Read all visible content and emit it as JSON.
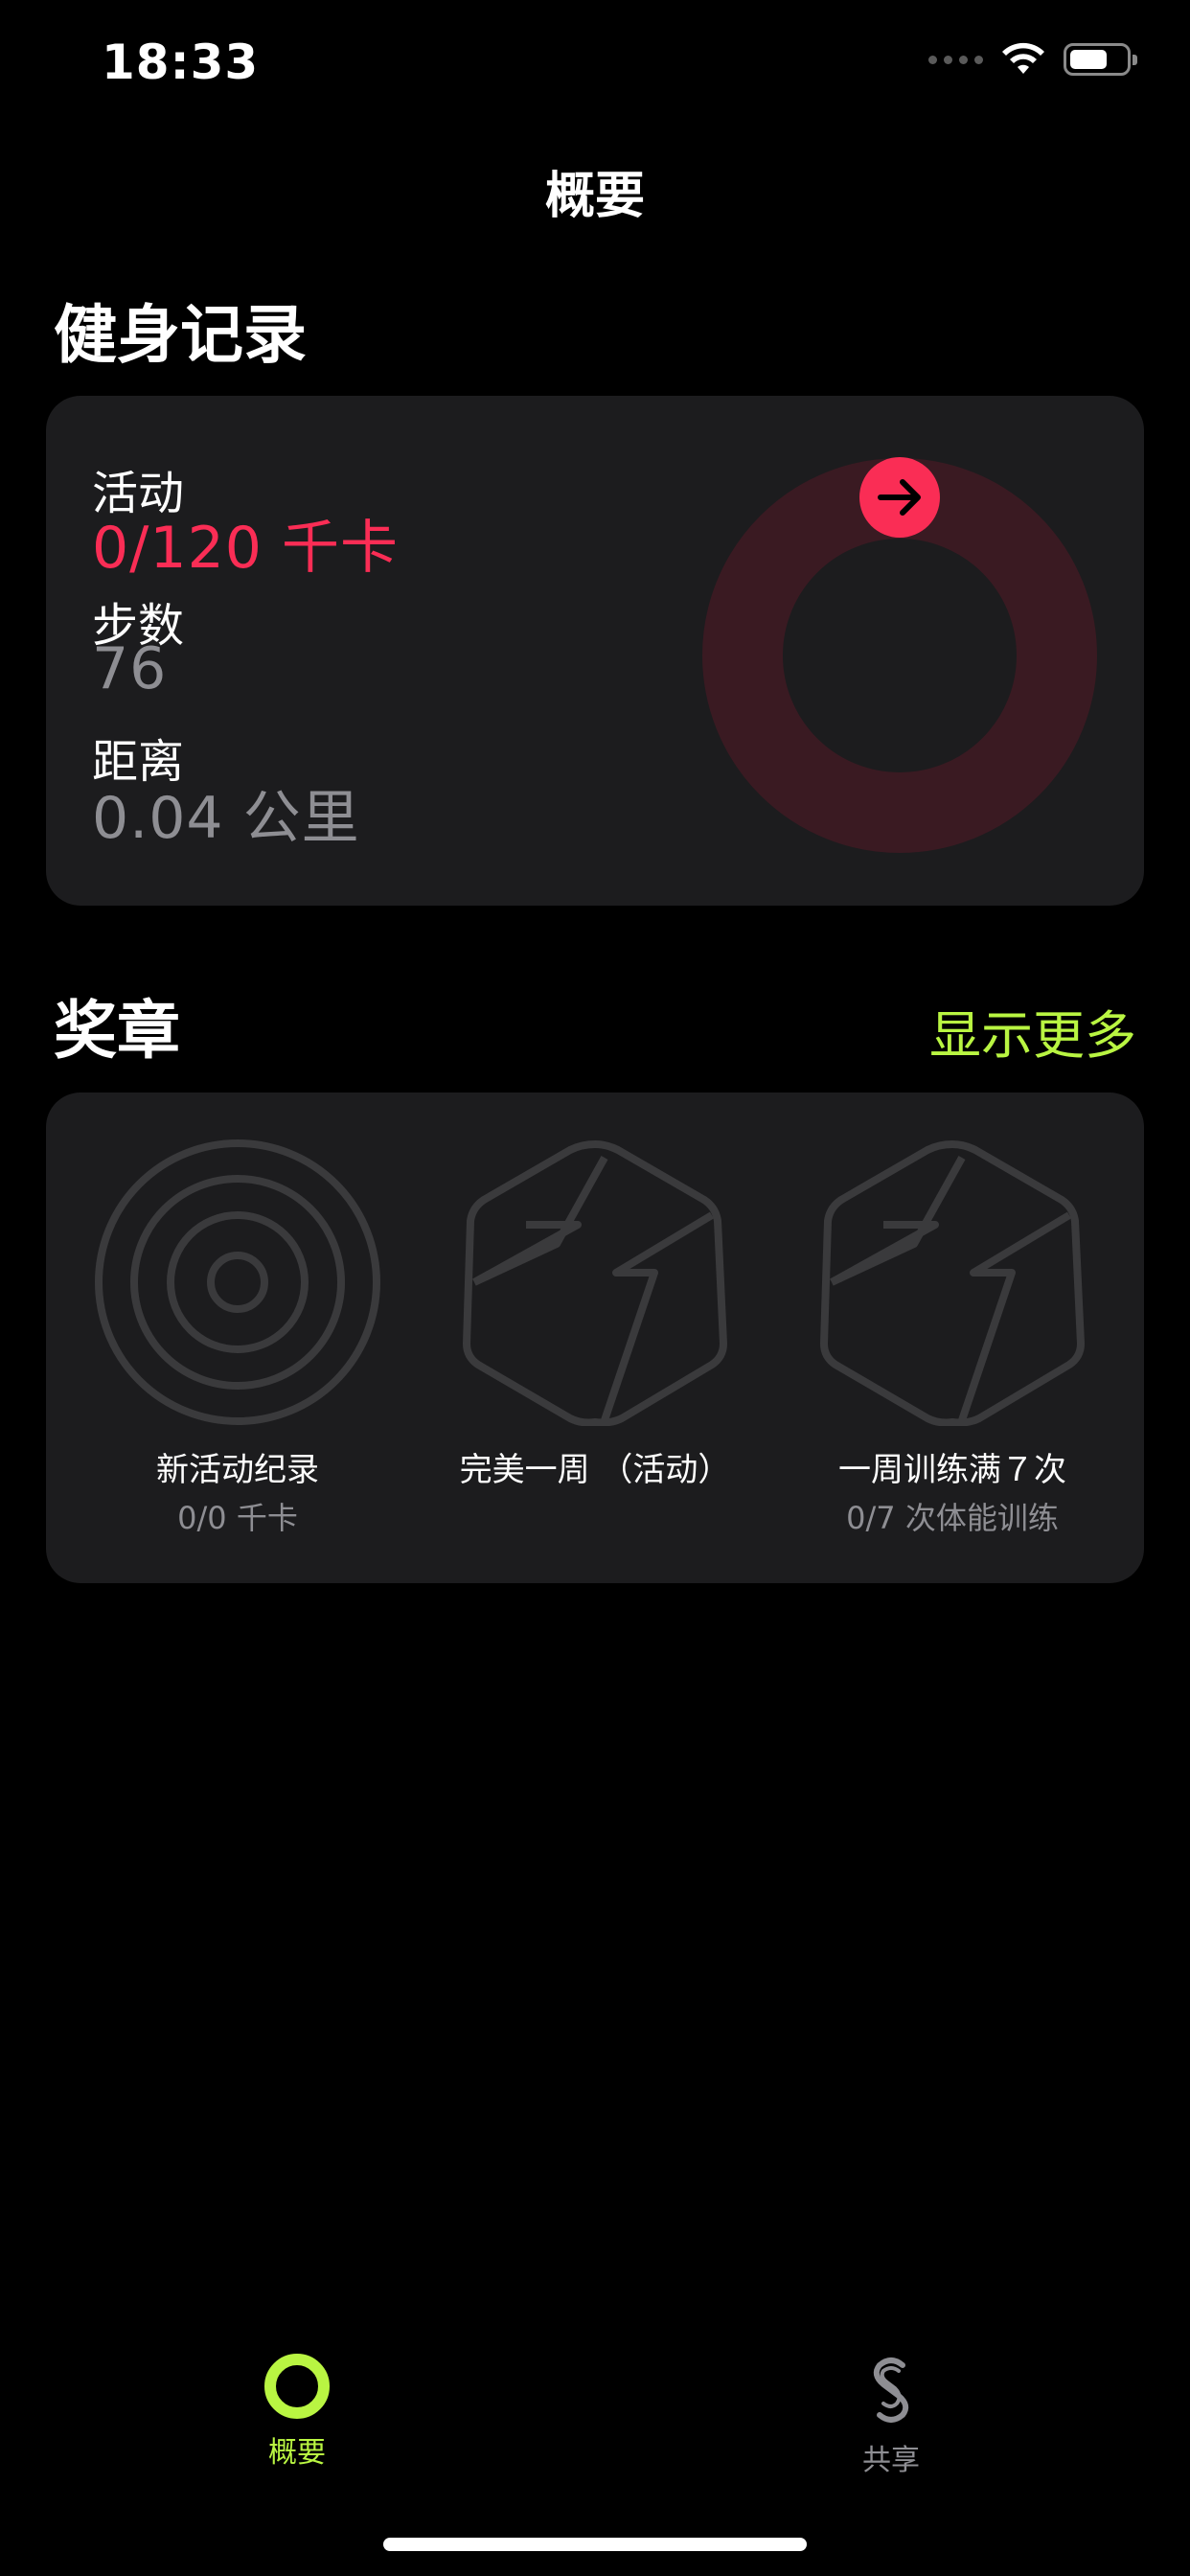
{
  "status_bar": {
    "time": "18:33"
  },
  "nav": {
    "title": "概要"
  },
  "fitness_record": {
    "section_title": "健身记录",
    "metrics": [
      {
        "label": "活动",
        "value": "0/120 千卡"
      },
      {
        "label": "步数",
        "value": "76"
      },
      {
        "label": "距离",
        "value": "0.04 公里"
      }
    ],
    "ring": {
      "progress_fraction": 0,
      "color": "#fa2d55",
      "track_color": "#3a1a22",
      "icon": "arrow-right-icon"
    }
  },
  "awards": {
    "section_title": "奖章",
    "show_more_label": "显示更多",
    "badges": [
      {
        "title": "新活动纪录",
        "subtitle": "0/0 千卡",
        "icon": "concentric-rings-icon"
      },
      {
        "title": "完美一周 （活动）",
        "subtitle": "",
        "icon": "hexagon-badge-icon"
      },
      {
        "title": "一周训练满７次",
        "subtitle": "0/7 次体能训练",
        "icon": "hexagon-badge-icon"
      }
    ]
  },
  "tab_bar": {
    "tabs": [
      {
        "label": "概要",
        "icon": "activity-ring-icon",
        "active": true,
        "color": "#b9f542"
      },
      {
        "label": "共享",
        "icon": "sharing-icon",
        "active": false,
        "color": "#8e8e93"
      }
    ]
  }
}
